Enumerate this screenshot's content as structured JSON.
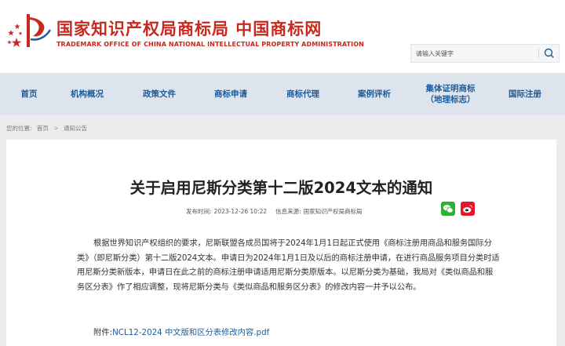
{
  "header": {
    "title": "国家知识产权局商标局  中国商标网",
    "subtitle": "TRADEMARK OFFICE OF CHINA NATIONAL INTELLECTUAL PROPERTY ADMINISTRATION",
    "logo_icon": "cnipa-logo-icon",
    "brand_color": "#c8281e",
    "search": {
      "placeholder": "请输入关键字",
      "button_icon": "search-icon"
    }
  },
  "nav": {
    "color": "#1b5c9b",
    "items": [
      {
        "label": "首页"
      },
      {
        "label": "机构概况"
      },
      {
        "label": "政策文件"
      },
      {
        "label": "商标申请"
      },
      {
        "label": "商标代理"
      },
      {
        "label": "案例评析"
      },
      {
        "label": "集体证明商标\n（地理标志）"
      },
      {
        "label": "国际注册"
      }
    ]
  },
  "breadcrumb": {
    "prefix": "您的位置:",
    "items": [
      "首页",
      "通知公告"
    ],
    "separator": ">"
  },
  "article": {
    "title": "关于启用尼斯分类第十二版2024文本的通知",
    "meta": {
      "published_label": "发布时间:",
      "published_value": "2023-12-26 10:22",
      "source_label": "信息来源:",
      "source_value": "国家知识产权局商标局"
    },
    "share": {
      "wechat_icon": "wechat-icon",
      "weibo_icon": "weibo-icon"
    },
    "body": "根据世界知识产权组织的要求，尼斯联盟各成员国将于2024年1月1日起正式使用《商标注册用商品和服务国际分类》（即尼斯分类）第十二版2024文本。申请日为2024年1月1日及以后的商标注册申请，在进行商品服务项目分类时适用尼斯分类新版本，申请日在此之前的商标注册申请适用尼斯分类原版本。以尼斯分类为基础，我局对《类似商品和服务区分表》作了相应调整，现将尼斯分类与《类似商品和服务区分表》的修改内容一并予以公布。",
    "attachment_label": "附件:",
    "attachment_link": "NCL12-2024 中文版和区分表修改内容.pdf"
  }
}
